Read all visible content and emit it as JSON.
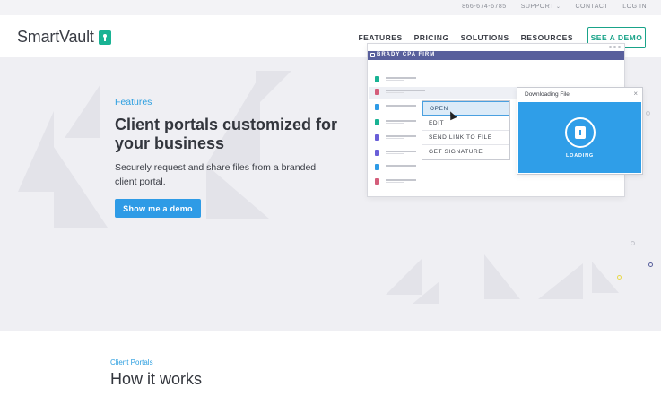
{
  "topbar": {
    "phone": "866-674-6785",
    "support": "SUPPORT",
    "contact": "CONTACT",
    "login": "LOG IN"
  },
  "nav": {
    "logo": "SmartVault",
    "menu": [
      "FEATURES",
      "PRICING",
      "SOLUTIONS",
      "RESOURCES"
    ],
    "demo": "SEE A DEMO"
  },
  "hero": {
    "eyebrow": "Features",
    "headline": "Client portals customized for your business",
    "subtext": "Securely request and share files from a branded client portal.",
    "cta": "Show me a demo"
  },
  "mockup": {
    "firm": "BRADY CPA FIRM",
    "menu": [
      "OPEN",
      "EDIT",
      "SEND LINK TO FILE",
      "GET SIGNATURE"
    ],
    "download_title": "Downloading File",
    "close": "×",
    "loading": "LOADING",
    "file_colors": [
      "#19b394",
      "#d45d7a",
      "#2e9be6",
      "#19b394",
      "#6a5fd8",
      "#6a5fd8",
      "#2e9be6",
      "#d45d7a"
    ]
  },
  "section2": {
    "eyebrow": "Client Portals",
    "title": "How it works"
  },
  "colors": {
    "accent": "#2e9be6",
    "brand": "#19b394",
    "firm_bar": "#585f9c"
  }
}
